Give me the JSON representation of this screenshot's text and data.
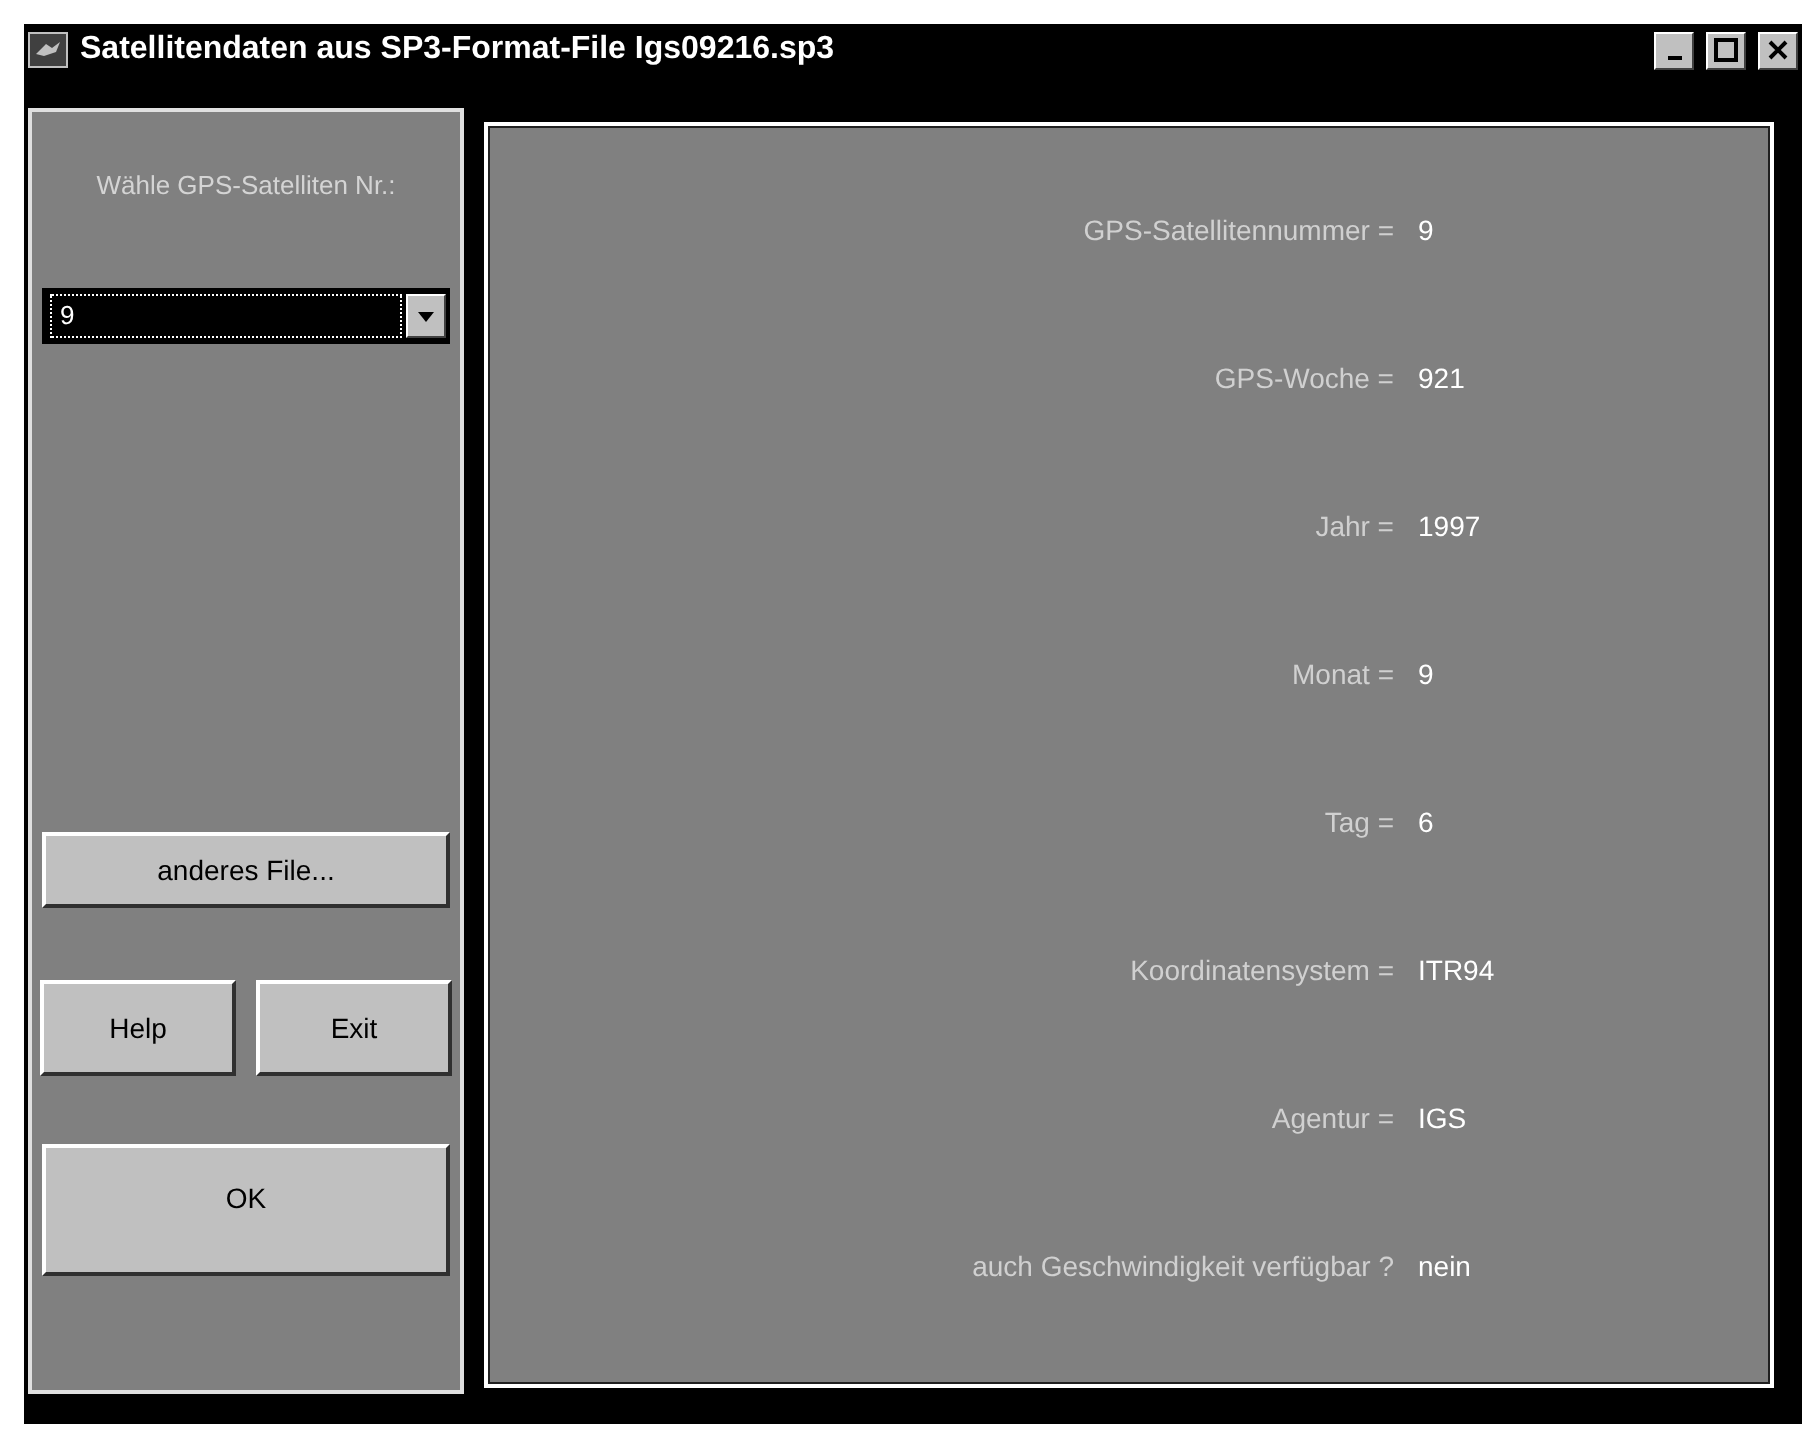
{
  "window": {
    "title": "Satellitendaten aus SP3-Format-File Igs09216.sp3"
  },
  "satellite_select": {
    "label": "Wähle GPS-Satelliten Nr.:",
    "value": "9"
  },
  "buttons": [
    {
      "label": "anderes File...",
      "kind": "wide"
    },
    {
      "label": "Help",
      "kind": "half"
    },
    {
      "label": "Exit",
      "kind": "half"
    },
    {
      "label": "OK",
      "kind": "large"
    }
  ],
  "rows": [
    {
      "label": "GPS-Satellitennummer =",
      "value": "9"
    },
    {
      "label": "GPS-Woche =",
      "value": "921"
    },
    {
      "label": "Jahr =",
      "value": "1997"
    },
    {
      "label": "Monat =",
      "value": "9"
    },
    {
      "label": "Tag =",
      "value": "6"
    },
    {
      "label": "Koordinatensystem =",
      "value": "ITR94"
    },
    {
      "label": "Agentur =",
      "value": "IGS"
    },
    {
      "label": "auch Geschwindigkeit verfügbar ?",
      "value": "nein"
    }
  ]
}
